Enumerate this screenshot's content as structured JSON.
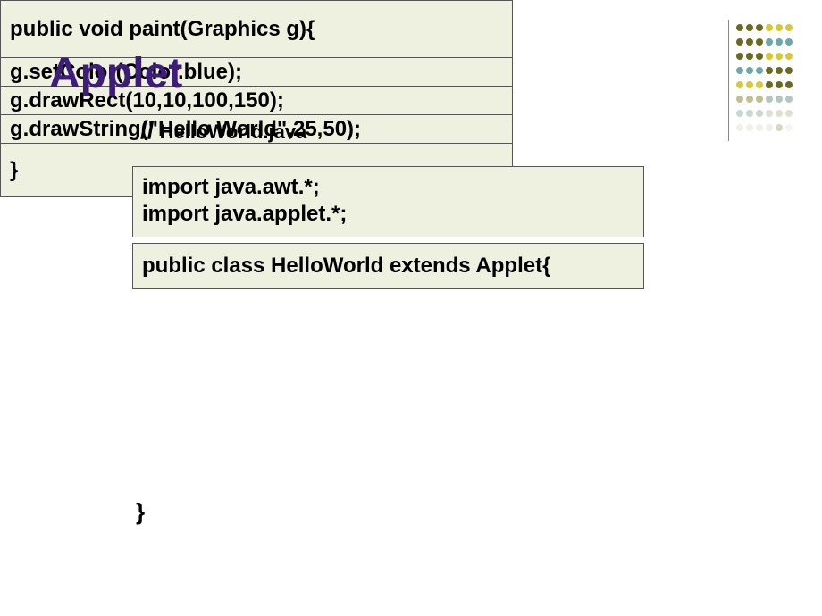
{
  "title": "Applet",
  "comment": {
    "slashes": "//",
    "filename": " HelloWorld.java"
  },
  "box1": {
    "line1": "import java.awt.*;",
    "line2": "import java.applet.*;"
  },
  "box2": {
    "line1": "public class HelloWorld extends Applet{"
  },
  "box3": {
    "method_header": "public void paint(Graphics g){",
    "line_setColor": " g.setColor(Color.blue);",
    "line_drawRect": " g.drawRect(10,10,100,150);",
    "line_drawString": " g.drawString(\"Hello World\",25,50);",
    "closing_inner": " }"
  },
  "closing_outer": "}",
  "decoration": {
    "colors": {
      "dark_olive": "#6b6b20",
      "teal": "#6ba8a8",
      "yellow": "#d8c838"
    }
  }
}
